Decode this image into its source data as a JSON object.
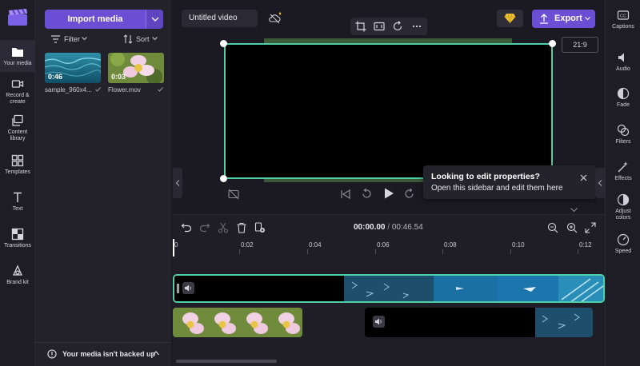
{
  "left_nav": {
    "items": [
      {
        "label_1": "Your media",
        "label_2": "",
        "icon": "folder-icon"
      },
      {
        "label_1": "Record &",
        "label_2": "create",
        "icon": "camera-icon"
      },
      {
        "label_1": "Content",
        "label_2": "library",
        "icon": "library-icon"
      },
      {
        "label_1": "Templates",
        "label_2": "",
        "icon": "templates-icon"
      },
      {
        "label_1": "Text",
        "label_2": "",
        "icon": "text-icon"
      },
      {
        "label_1": "Transitions",
        "label_2": "",
        "icon": "transitions-icon"
      },
      {
        "label_1": "Brand kit",
        "label_2": "",
        "icon": "brand-kit-icon"
      }
    ]
  },
  "media_panel": {
    "import_label": "Import media",
    "filter_label": "Filter",
    "sort_label": "Sort",
    "items": [
      {
        "name": "sample_960x4...",
        "duration": "0:46"
      },
      {
        "name": "Flower.mov",
        "duration": "0:03"
      }
    ],
    "backup_text": "Your media isn't backed up"
  },
  "header": {
    "title_value": "Untitled video",
    "export_label": "Export"
  },
  "preview": {
    "aspect_ratio": "21:9"
  },
  "tooltip": {
    "title": "Looking to edit properties?",
    "body": "Open this sidebar and edit them here"
  },
  "right_panel": {
    "items": [
      {
        "label_1": "Captions",
        "label_2": "",
        "icon": "captions-icon"
      },
      {
        "label_1": "Audio",
        "label_2": "",
        "icon": "audio-icon"
      },
      {
        "label_1": "Fade",
        "label_2": "",
        "icon": "fade-icon"
      },
      {
        "label_1": "Filters",
        "label_2": "",
        "icon": "filters-icon"
      },
      {
        "label_1": "Effects",
        "label_2": "",
        "icon": "effects-icon"
      },
      {
        "label_1": "Adjust",
        "label_2": "colors",
        "icon": "adjust-colors-icon"
      },
      {
        "label_1": "Speed",
        "label_2": "",
        "icon": "speed-icon"
      }
    ]
  },
  "timeline": {
    "current_time": "00:00.00",
    "separator": "/",
    "total_time": "00:46.54",
    "ruler_labels": [
      "0",
      "0:02",
      "0:04",
      "0:06",
      "0:08",
      "0:10",
      "0:12"
    ]
  },
  "colors": {
    "accent": "#6a4ed3",
    "selection": "#4fcfa8",
    "background": "#1b1a22"
  }
}
